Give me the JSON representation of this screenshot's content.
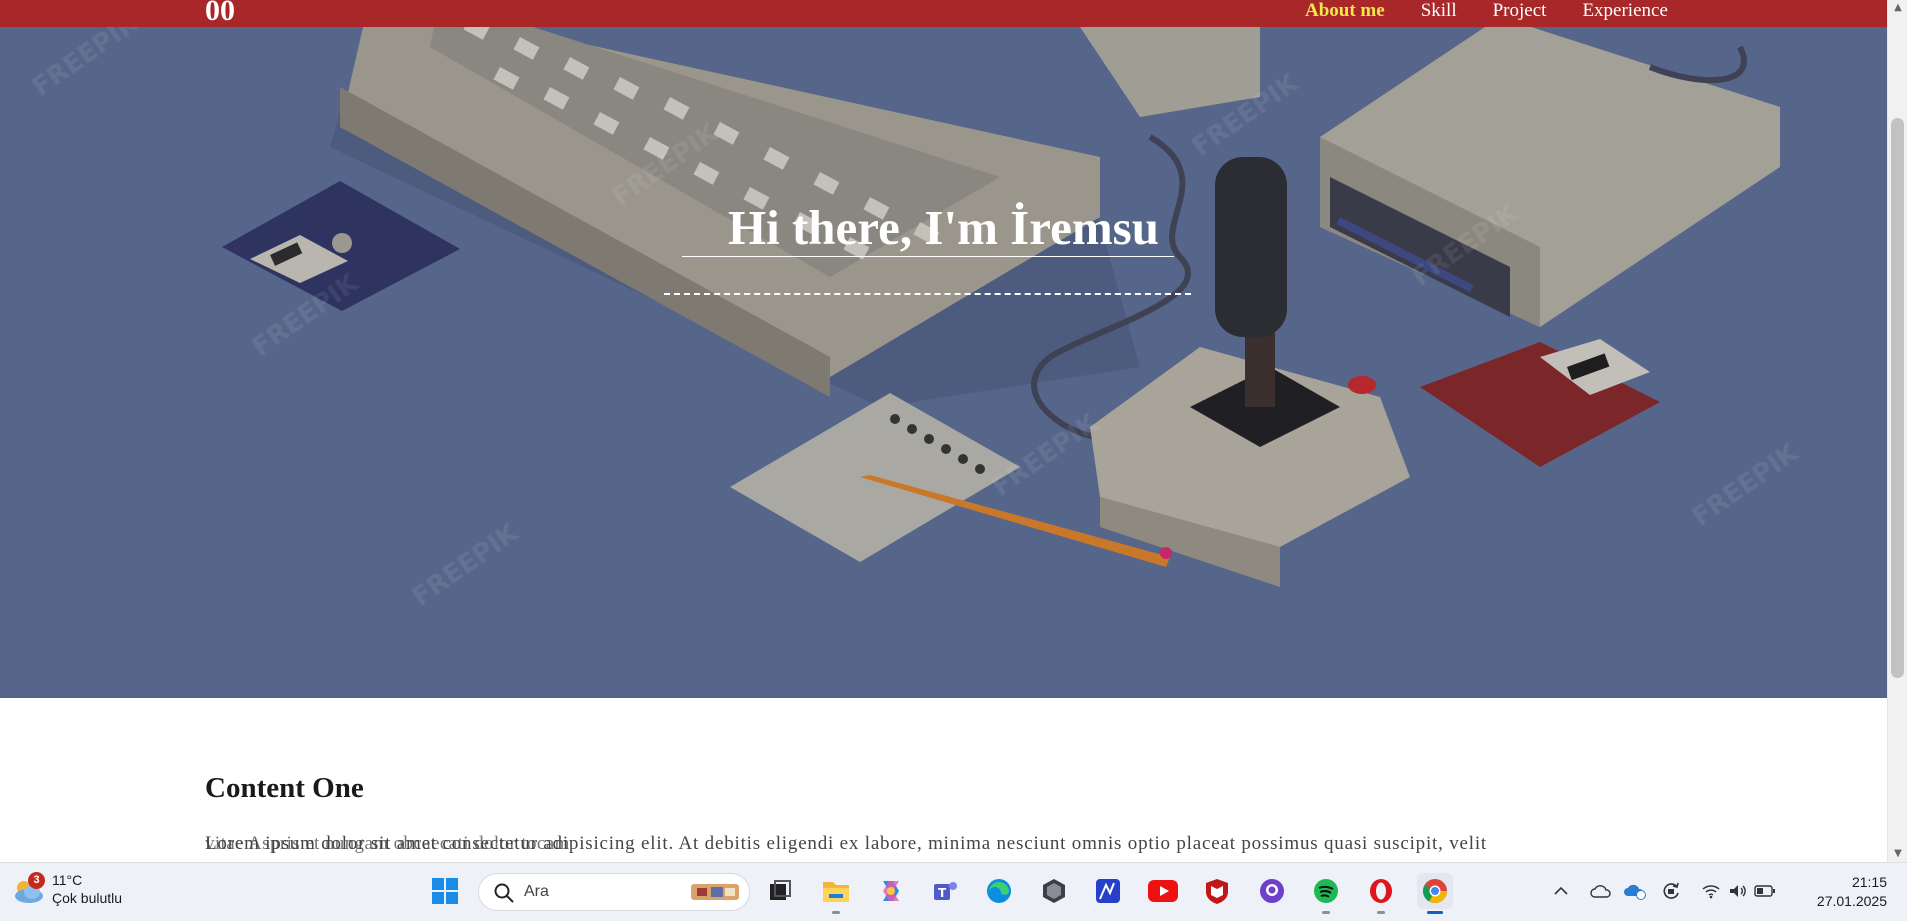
{
  "navbar": {
    "brand": "00",
    "links": [
      {
        "label": "About me",
        "active": true
      },
      {
        "label": "Skill",
        "active": false
      },
      {
        "label": "Project",
        "active": false
      },
      {
        "label": "Experience",
        "active": false
      }
    ]
  },
  "hero": {
    "title": "Hi there, I'm İremsu"
  },
  "content": {
    "title": "Content One",
    "text": "Lorem ipsum dolor sit amet consectetur adipisicing elit. At debitis eligendi ex labore, minima nesciunt omnis optio placeat possimus quasi suscipit, velit",
    "overlap_text": "vitae Aspris et nungam obcaecati dolor tocam"
  },
  "taskbar": {
    "weather": {
      "badge": "3",
      "temp": "11°C",
      "desc": "Çok bulutlu"
    },
    "search_placeholder": "Ara",
    "apps": [
      "windows-start-icon",
      "task-view-icon",
      "file-explorer-icon",
      "copilot-icon",
      "teams-icon",
      "edge-icon",
      "dark-app-icon",
      "mailbird-icon",
      "youtube-icon",
      "mcafee-icon",
      "github-icon",
      "spotify-icon",
      "opera-icon",
      "chrome-icon"
    ],
    "clock": {
      "time": "21:15",
      "date": "27.01.2025"
    }
  },
  "colors": {
    "navbar": "#a8282a",
    "active_link": "#f5e74a",
    "hero_bg": "#56658a"
  }
}
